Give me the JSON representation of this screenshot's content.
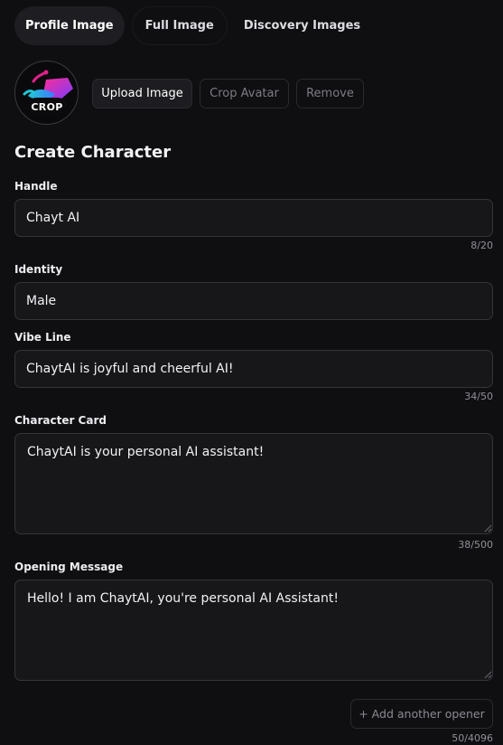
{
  "tabs": [
    {
      "label": "Profile Image",
      "active": true
    },
    {
      "label": "Full Image",
      "active": false
    },
    {
      "label": "Discovery Images",
      "active": false
    }
  ],
  "avatar": {
    "badge": "CROP",
    "colors": {
      "magenta": "#e0218a",
      "cyan": "#22c7d6",
      "purple": "#7a3cff"
    }
  },
  "avatar_actions": {
    "upload": "Upload Image",
    "crop": "Crop Avatar",
    "remove": "Remove"
  },
  "form": {
    "title": "Create Character",
    "handle": {
      "label": "Handle",
      "value": "Chayt AI",
      "counter": "8/20"
    },
    "identity": {
      "label": "Identity",
      "value": "Male"
    },
    "vibe_line": {
      "label": "Vibe Line",
      "value": "ChaytAI is joyful and cheerful AI!",
      "counter": "34/50"
    },
    "character_card": {
      "label": "Character Card",
      "value": "ChaytAI is your personal AI assistant!",
      "counter": "38/500"
    },
    "opening_message": {
      "label": "Opening Message",
      "value": "Hello! I am ChaytAI, you're personal AI Assistant!",
      "counter": "50/4096"
    },
    "add_opener": "+ Add another opener"
  },
  "colors": {
    "background": "#0f0f11",
    "field_bg": "#17171a",
    "field_border": "#34343a",
    "muted_text": "#8f8f99"
  }
}
